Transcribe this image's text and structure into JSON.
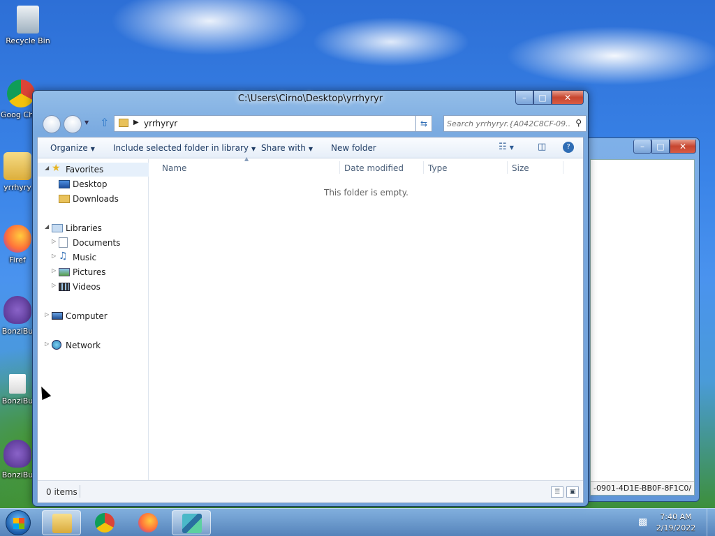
{
  "desktop": {
    "icons": [
      {
        "label": "Recycle Bin"
      },
      {
        "label": "Goog Chro"
      },
      {
        "label": "yrrhyry"
      },
      {
        "label": "Firef"
      },
      {
        "label": "BonziBu"
      },
      {
        "label": "BonziBu"
      },
      {
        "label": "BonziBu"
      }
    ]
  },
  "bg_window": {
    "path_text": "-0901-4D1E-BB0F-8F1C0/"
  },
  "window": {
    "title": "C:\\Users\\Cirno\\Desktop\\yrrhyryr",
    "address_segment": "yrrhyryr",
    "search_placeholder": "Search yrrhyryr.{A042C8CF-09...",
    "toolbar": {
      "organize": "Organize",
      "include": "Include selected folder in library",
      "share": "Share with",
      "new_folder": "New folder"
    },
    "nav": {
      "favorites": "Favorites",
      "desktop": "Desktop",
      "downloads": "Downloads",
      "libraries": "Libraries",
      "documents": "Documents",
      "music": "Music",
      "pictures": "Pictures",
      "videos": "Videos",
      "computer": "Computer",
      "network": "Network"
    },
    "columns": {
      "name": "Name",
      "date": "Date modified",
      "type": "Type",
      "size": "Size"
    },
    "empty_message": "This folder is empty.",
    "status_count": "0 items"
  },
  "taskbar": {
    "time": "7:40 AM",
    "date": "2/19/2022"
  },
  "colors": {
    "accent": "#3a84e8",
    "window_frame": "#7aaae0"
  }
}
